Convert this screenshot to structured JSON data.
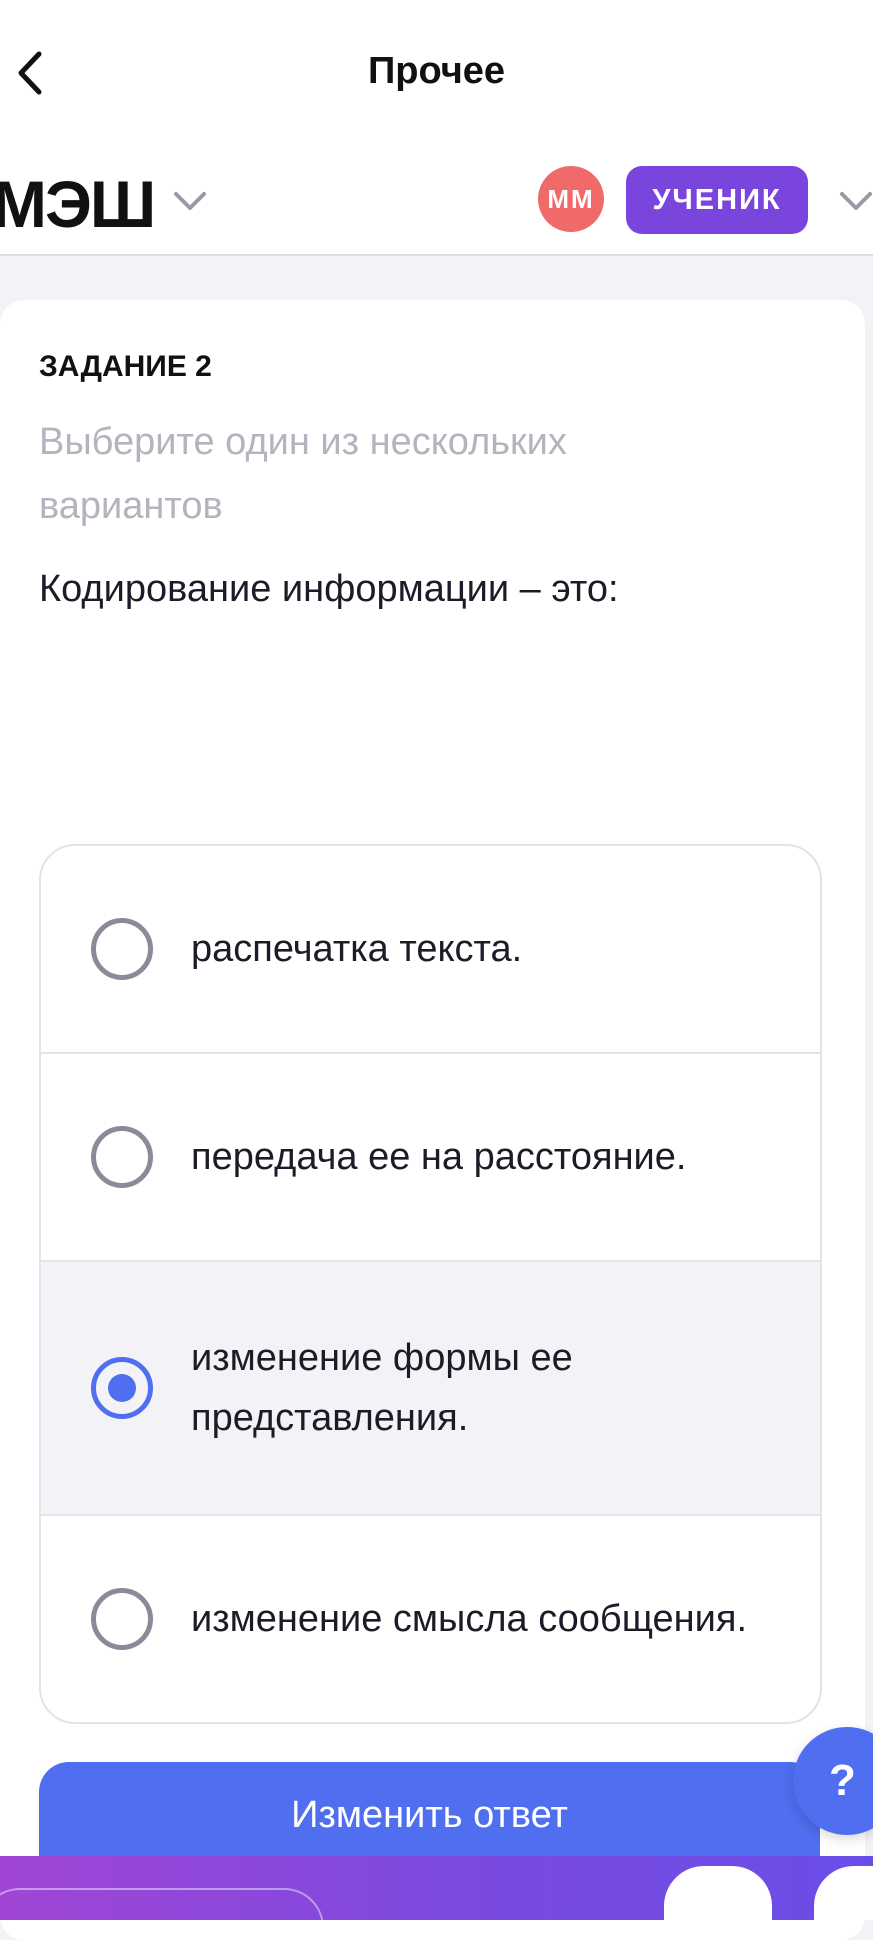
{
  "header": {
    "title": "Прочее",
    "back_icon": "chevron-left-icon"
  },
  "brand": {
    "logo_text": "МЭШ",
    "avatar_initials": "ММ",
    "role": "УЧЕНИК",
    "colors": {
      "avatar": "#f06a6a",
      "role_badge": "#7a45dc"
    }
  },
  "task": {
    "label": "ЗАДАНИЕ 2",
    "instruction": "Выберите один из нескольких вариантов",
    "question": "Кодирование информации – это:",
    "options": [
      {
        "label": "распечатка текста.",
        "selected": false
      },
      {
        "label": "передача ее на расстояние.",
        "selected": false
      },
      {
        "label": "изменение формы ее представления.",
        "selected": true
      },
      {
        "label": "изменение смысла сообщения.",
        "selected": false
      }
    ],
    "accent_color": "#4f6ef0"
  },
  "actions": {
    "submit_label": "Изменить ответ",
    "help_label": "?"
  }
}
